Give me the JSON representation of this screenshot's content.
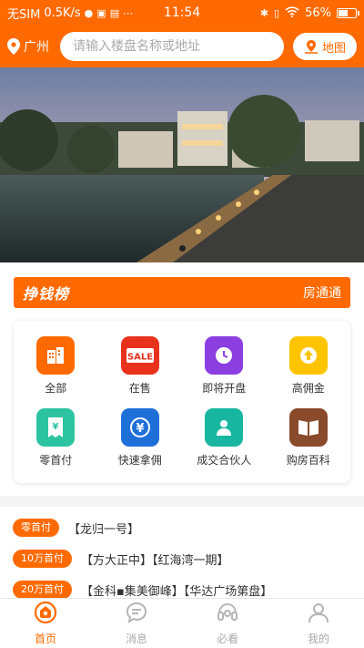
{
  "status_bar": {
    "carrier": "无SIM",
    "speed": "0.5K/s",
    "time": "11:54",
    "battery": "56%",
    "battery_level": 0.56
  },
  "header": {
    "city": "广州",
    "search_placeholder": "请输入楼盘名称或地址",
    "map_label": "地图"
  },
  "banner": {
    "slide_count": 1,
    "active_index": 0
  },
  "rank": {
    "title": "挣钱榜",
    "scroll_text": "房通通"
  },
  "categories": [
    {
      "label": "全部",
      "icon": "buildings-icon",
      "color": "#ff6a00"
    },
    {
      "label": "在售",
      "icon": "sale-icon",
      "color": "#e8321c"
    },
    {
      "label": "即将开盘",
      "icon": "clock-icon",
      "color": "#8b3fe0"
    },
    {
      "label": "高佣金",
      "icon": "arrow-up-coin-icon",
      "color": "#ffc400"
    },
    {
      "label": "零首付",
      "icon": "receipt-yuan-icon",
      "color": "#2cc4a0"
    },
    {
      "label": "快速拿佣",
      "icon": "yuan-coin-icon",
      "color": "#1f6fd9"
    },
    {
      "label": "成交合伙人",
      "icon": "partner-icon",
      "color": "#18b6a0"
    },
    {
      "label": "购房百科",
      "icon": "book-icon",
      "color": "#8a4a2c"
    }
  ],
  "promo_list": [
    {
      "tag": "零首付",
      "text": "【龙归一号】"
    },
    {
      "tag": "10万首付",
      "text": "【方大正中】【红海湾一期】"
    },
    {
      "tag": "20万首付",
      "text": "【金科▪集美御峰】【华达广场第盘】"
    }
  ],
  "tabbar": [
    {
      "label": "首页",
      "icon": "home-icon",
      "active": true
    },
    {
      "label": "消息",
      "icon": "message-icon",
      "active": false
    },
    {
      "label": "必看",
      "icon": "must-see-icon",
      "active": false
    },
    {
      "label": "我的",
      "icon": "profile-icon",
      "active": false
    }
  ],
  "colors": {
    "accent": "#ff6a00"
  }
}
